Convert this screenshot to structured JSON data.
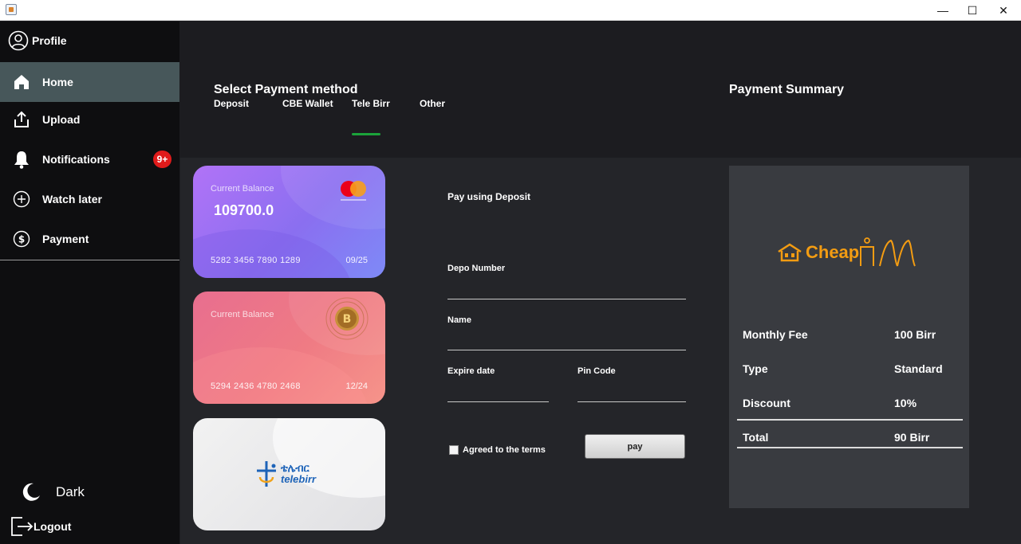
{
  "window": {
    "minimize_symbol": "—",
    "maximize_symbol": "☐",
    "close_symbol": "✕"
  },
  "sidebar": {
    "profile_label": "Profile",
    "items": [
      {
        "label": "Home",
        "icon": "home-icon",
        "active": true
      },
      {
        "label": "Upload",
        "icon": "upload-icon"
      },
      {
        "label": "Notifications",
        "icon": "bell-icon",
        "badge": "9+"
      },
      {
        "label": "Watch later",
        "icon": "plus-circle-icon"
      },
      {
        "label": "Payment",
        "icon": "dollar-circle-icon"
      }
    ],
    "theme_label": "Dark",
    "logout_label": "Logout"
  },
  "payment": {
    "heading": "Select Payment method",
    "tabs": [
      "Deposit",
      "CBE Wallet",
      "Tele Birr",
      "Other"
    ],
    "selected_tab": "Tele Birr",
    "cards": [
      {
        "label": "Current Balance",
        "balance": "109700.0",
        "number": "5282 3456 7890 1289",
        "expiry": "09/25",
        "brand": "mastercard"
      },
      {
        "label": "Current Balance",
        "number": "5294 2436 4780 2468",
        "expiry": "12/24"
      },
      {
        "brand_amharic": "ቴሌብር",
        "brand": "telebirr"
      }
    ],
    "form": {
      "title": "Pay using Deposit",
      "depo_label": "Depo Number",
      "name_label": "Name",
      "expire_label": "Expire date",
      "pin_label": "Pin Code",
      "terms_label": "Agreed to the terms",
      "pay_label": "pay"
    }
  },
  "summary": {
    "heading": "Payment Summary",
    "logo_text": "Cheap",
    "rows": [
      {
        "label": "Monthly Fee",
        "value": "100 Birr"
      },
      {
        "label": "Type",
        "value": "Standard"
      },
      {
        "label": "Discount",
        "value": "10%"
      },
      {
        "label": "Total",
        "value": "90 Birr"
      }
    ]
  },
  "colors": {
    "sidebar_bg": "#0e0e10",
    "active_item": "#47575a",
    "main_bg": "#1c1c20",
    "panel_bg": "#242529",
    "summary_bg": "#393b40",
    "badge": "#e01b1b",
    "tab_underline": "#1ba33a",
    "logo_orange": "#f39c12"
  }
}
